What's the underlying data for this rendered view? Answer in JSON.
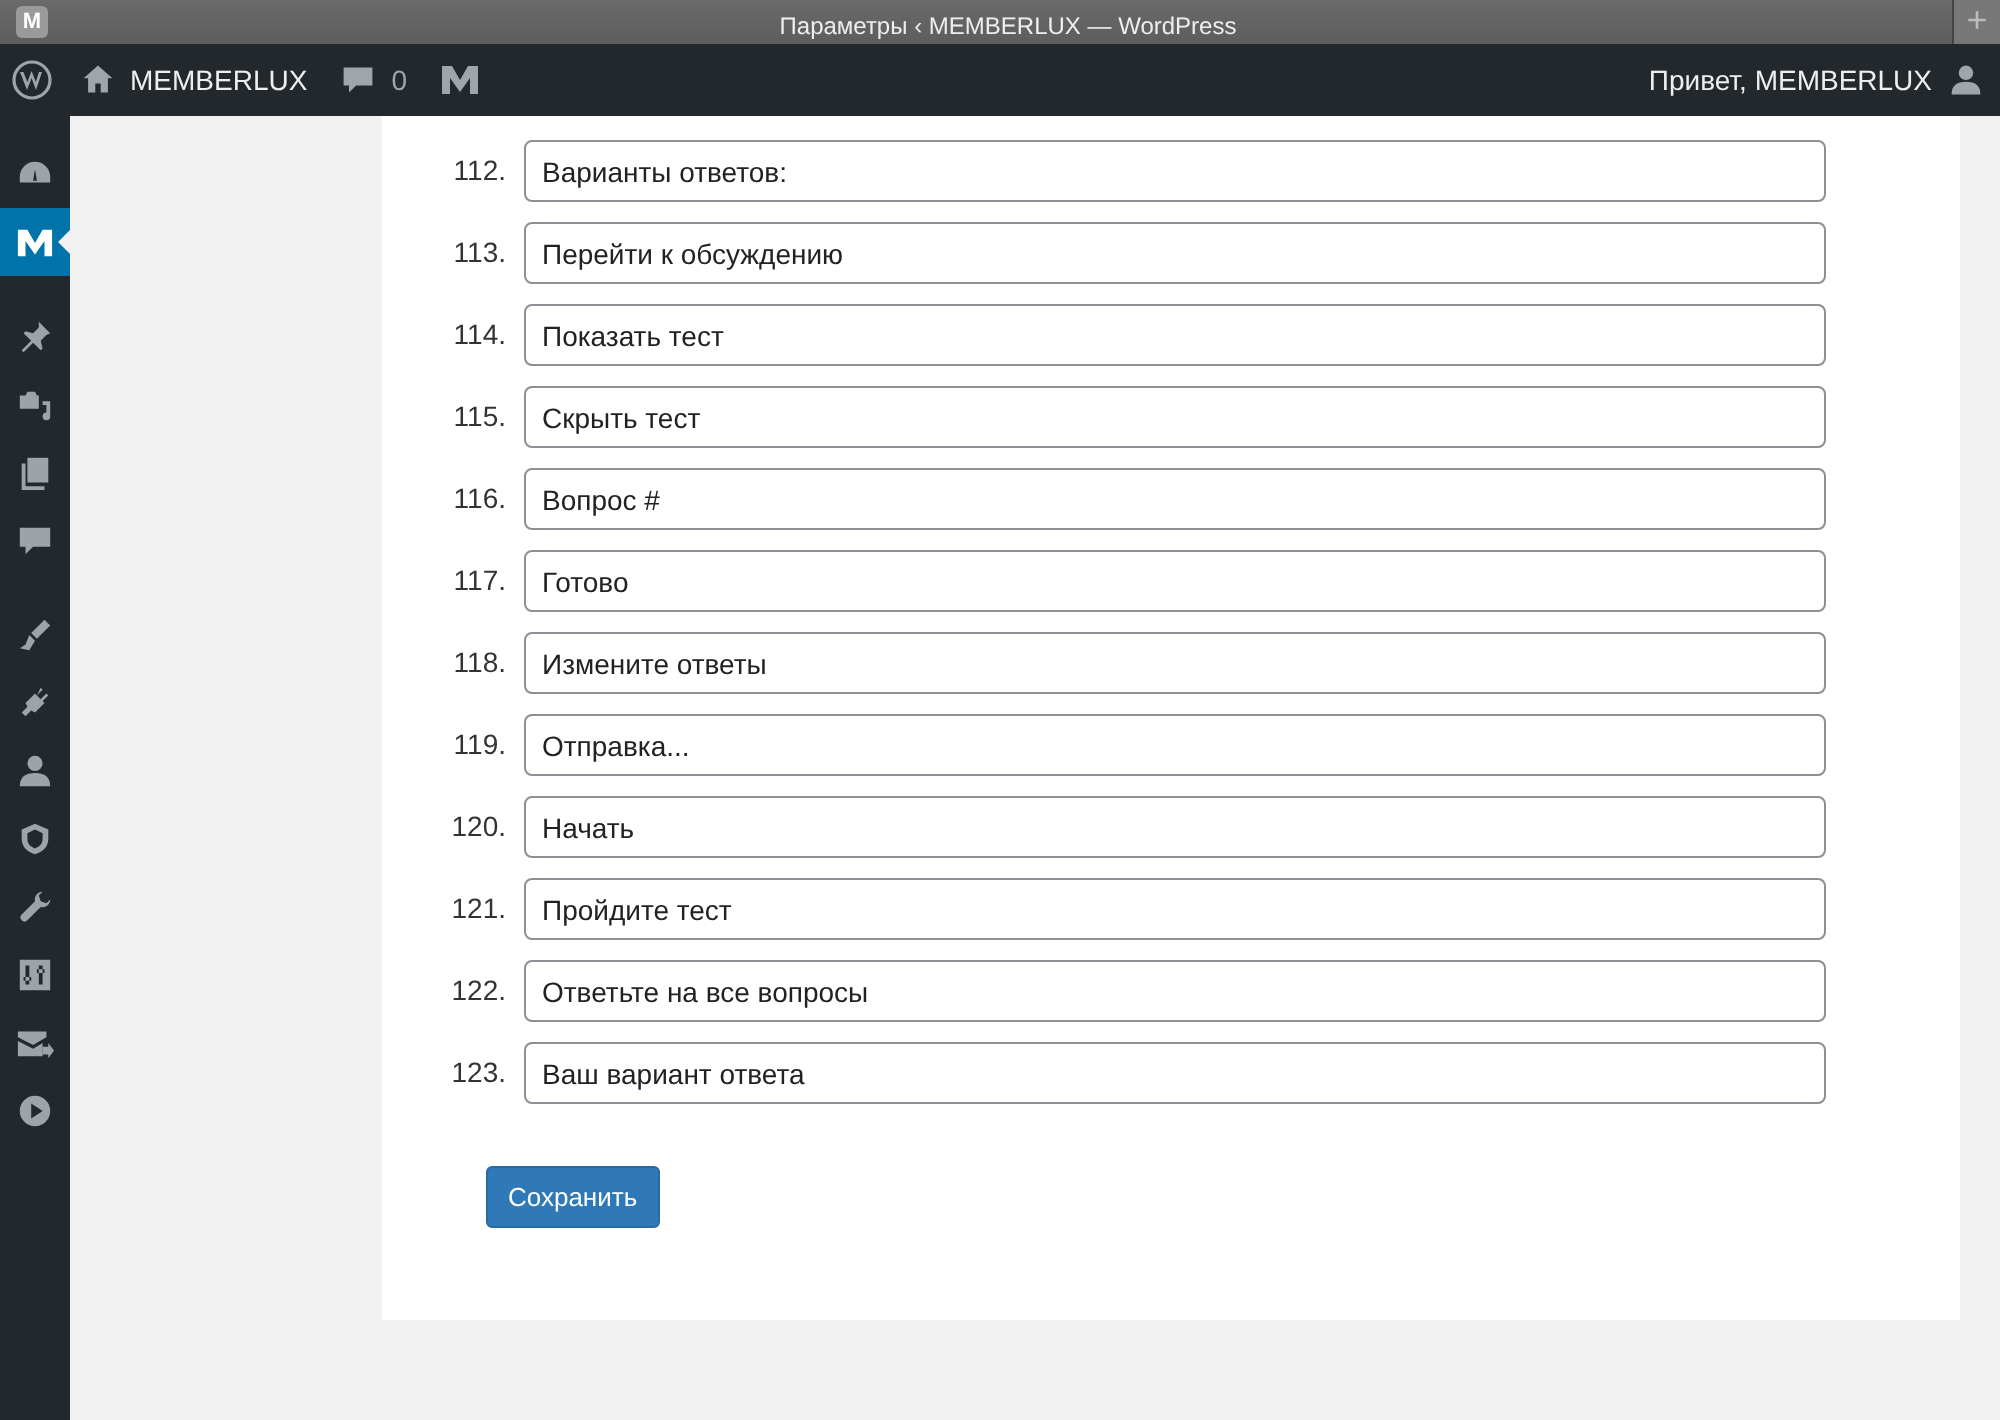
{
  "window": {
    "app_badge": "M",
    "title": "Параметры ‹ MEMBERLUX — WordPress",
    "new_tab": "+"
  },
  "admin_bar": {
    "site_name": "MEMBERLUX",
    "comments_count": "0",
    "greeting": "Привет, MEMBERLUX"
  },
  "sidebar": {
    "items": [
      {
        "kind": "dashboard",
        "selected": false
      },
      {
        "kind": "memberlux",
        "selected": true
      },
      {
        "kind": "separator"
      },
      {
        "kind": "posts",
        "selected": false
      },
      {
        "kind": "media",
        "selected": false
      },
      {
        "kind": "pages",
        "selected": false
      },
      {
        "kind": "comments",
        "selected": false
      },
      {
        "kind": "separator"
      },
      {
        "kind": "appearance",
        "selected": false
      },
      {
        "kind": "plugins",
        "selected": false
      },
      {
        "kind": "users",
        "selected": false
      },
      {
        "kind": "shield",
        "selected": false
      },
      {
        "kind": "tools",
        "selected": false
      },
      {
        "kind": "settings",
        "selected": false
      },
      {
        "kind": "mail",
        "selected": false
      },
      {
        "kind": "play",
        "selected": false
      }
    ]
  },
  "fields": [
    {
      "number": "112.",
      "value": "Варианты ответов:"
    },
    {
      "number": "113.",
      "value": "Перейти к обсуждению"
    },
    {
      "number": "114.",
      "value": "Показать тест"
    },
    {
      "number": "115.",
      "value": "Скрыть тест"
    },
    {
      "number": "116.",
      "value": "Вопрос #"
    },
    {
      "number": "117.",
      "value": "Готово"
    },
    {
      "number": "118.",
      "value": "Измените ответы"
    },
    {
      "number": "119.",
      "value": "Отправка..."
    },
    {
      "number": "120.",
      "value": "Начать"
    },
    {
      "number": "121.",
      "value": "Пройдите тест"
    },
    {
      "number": "122.",
      "value": "Ответьте на все вопросы"
    },
    {
      "number": "123.",
      "value": "Ваш вариант ответа"
    }
  ],
  "save_button": "Сохранить"
}
